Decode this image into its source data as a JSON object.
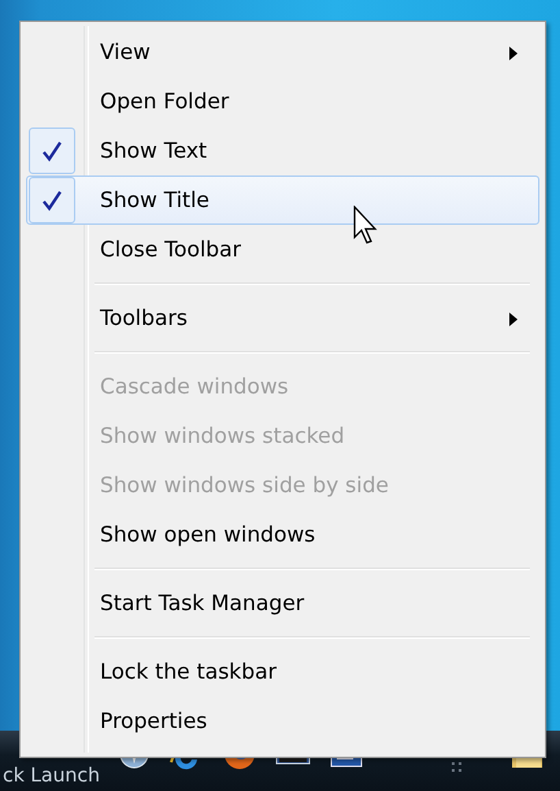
{
  "menu": {
    "items": [
      {
        "kind": "item",
        "label": "View",
        "checked": false,
        "disabled": false,
        "submenu": true,
        "selected": false
      },
      {
        "kind": "item",
        "label": "Open Folder",
        "checked": false,
        "disabled": false,
        "submenu": false,
        "selected": false
      },
      {
        "kind": "item",
        "label": "Show Text",
        "checked": true,
        "disabled": false,
        "submenu": false,
        "selected": false
      },
      {
        "kind": "item",
        "label": "Show Title",
        "checked": true,
        "disabled": false,
        "submenu": false,
        "selected": true
      },
      {
        "kind": "item",
        "label": "Close Toolbar",
        "checked": false,
        "disabled": false,
        "submenu": false,
        "selected": false
      },
      {
        "kind": "separator"
      },
      {
        "kind": "item",
        "label": "Toolbars",
        "checked": false,
        "disabled": false,
        "submenu": true,
        "selected": false
      },
      {
        "kind": "separator"
      },
      {
        "kind": "item",
        "label": "Cascade windows",
        "checked": false,
        "disabled": true,
        "submenu": false,
        "selected": false
      },
      {
        "kind": "item",
        "label": "Show windows stacked",
        "checked": false,
        "disabled": true,
        "submenu": false,
        "selected": false
      },
      {
        "kind": "item",
        "label": "Show windows side by side",
        "checked": false,
        "disabled": true,
        "submenu": false,
        "selected": false
      },
      {
        "kind": "item",
        "label": "Show open windows",
        "checked": false,
        "disabled": false,
        "submenu": false,
        "selected": false
      },
      {
        "kind": "separator"
      },
      {
        "kind": "item",
        "label": "Start Task Manager",
        "checked": false,
        "disabled": false,
        "submenu": false,
        "selected": false
      },
      {
        "kind": "separator"
      },
      {
        "kind": "item",
        "label": "Lock the taskbar",
        "checked": false,
        "disabled": false,
        "submenu": false,
        "selected": false
      },
      {
        "kind": "item",
        "label": "Properties",
        "checked": false,
        "disabled": false,
        "submenu": false,
        "selected": false
      }
    ]
  },
  "taskbar": {
    "toolbar_label": "ck Launch"
  }
}
